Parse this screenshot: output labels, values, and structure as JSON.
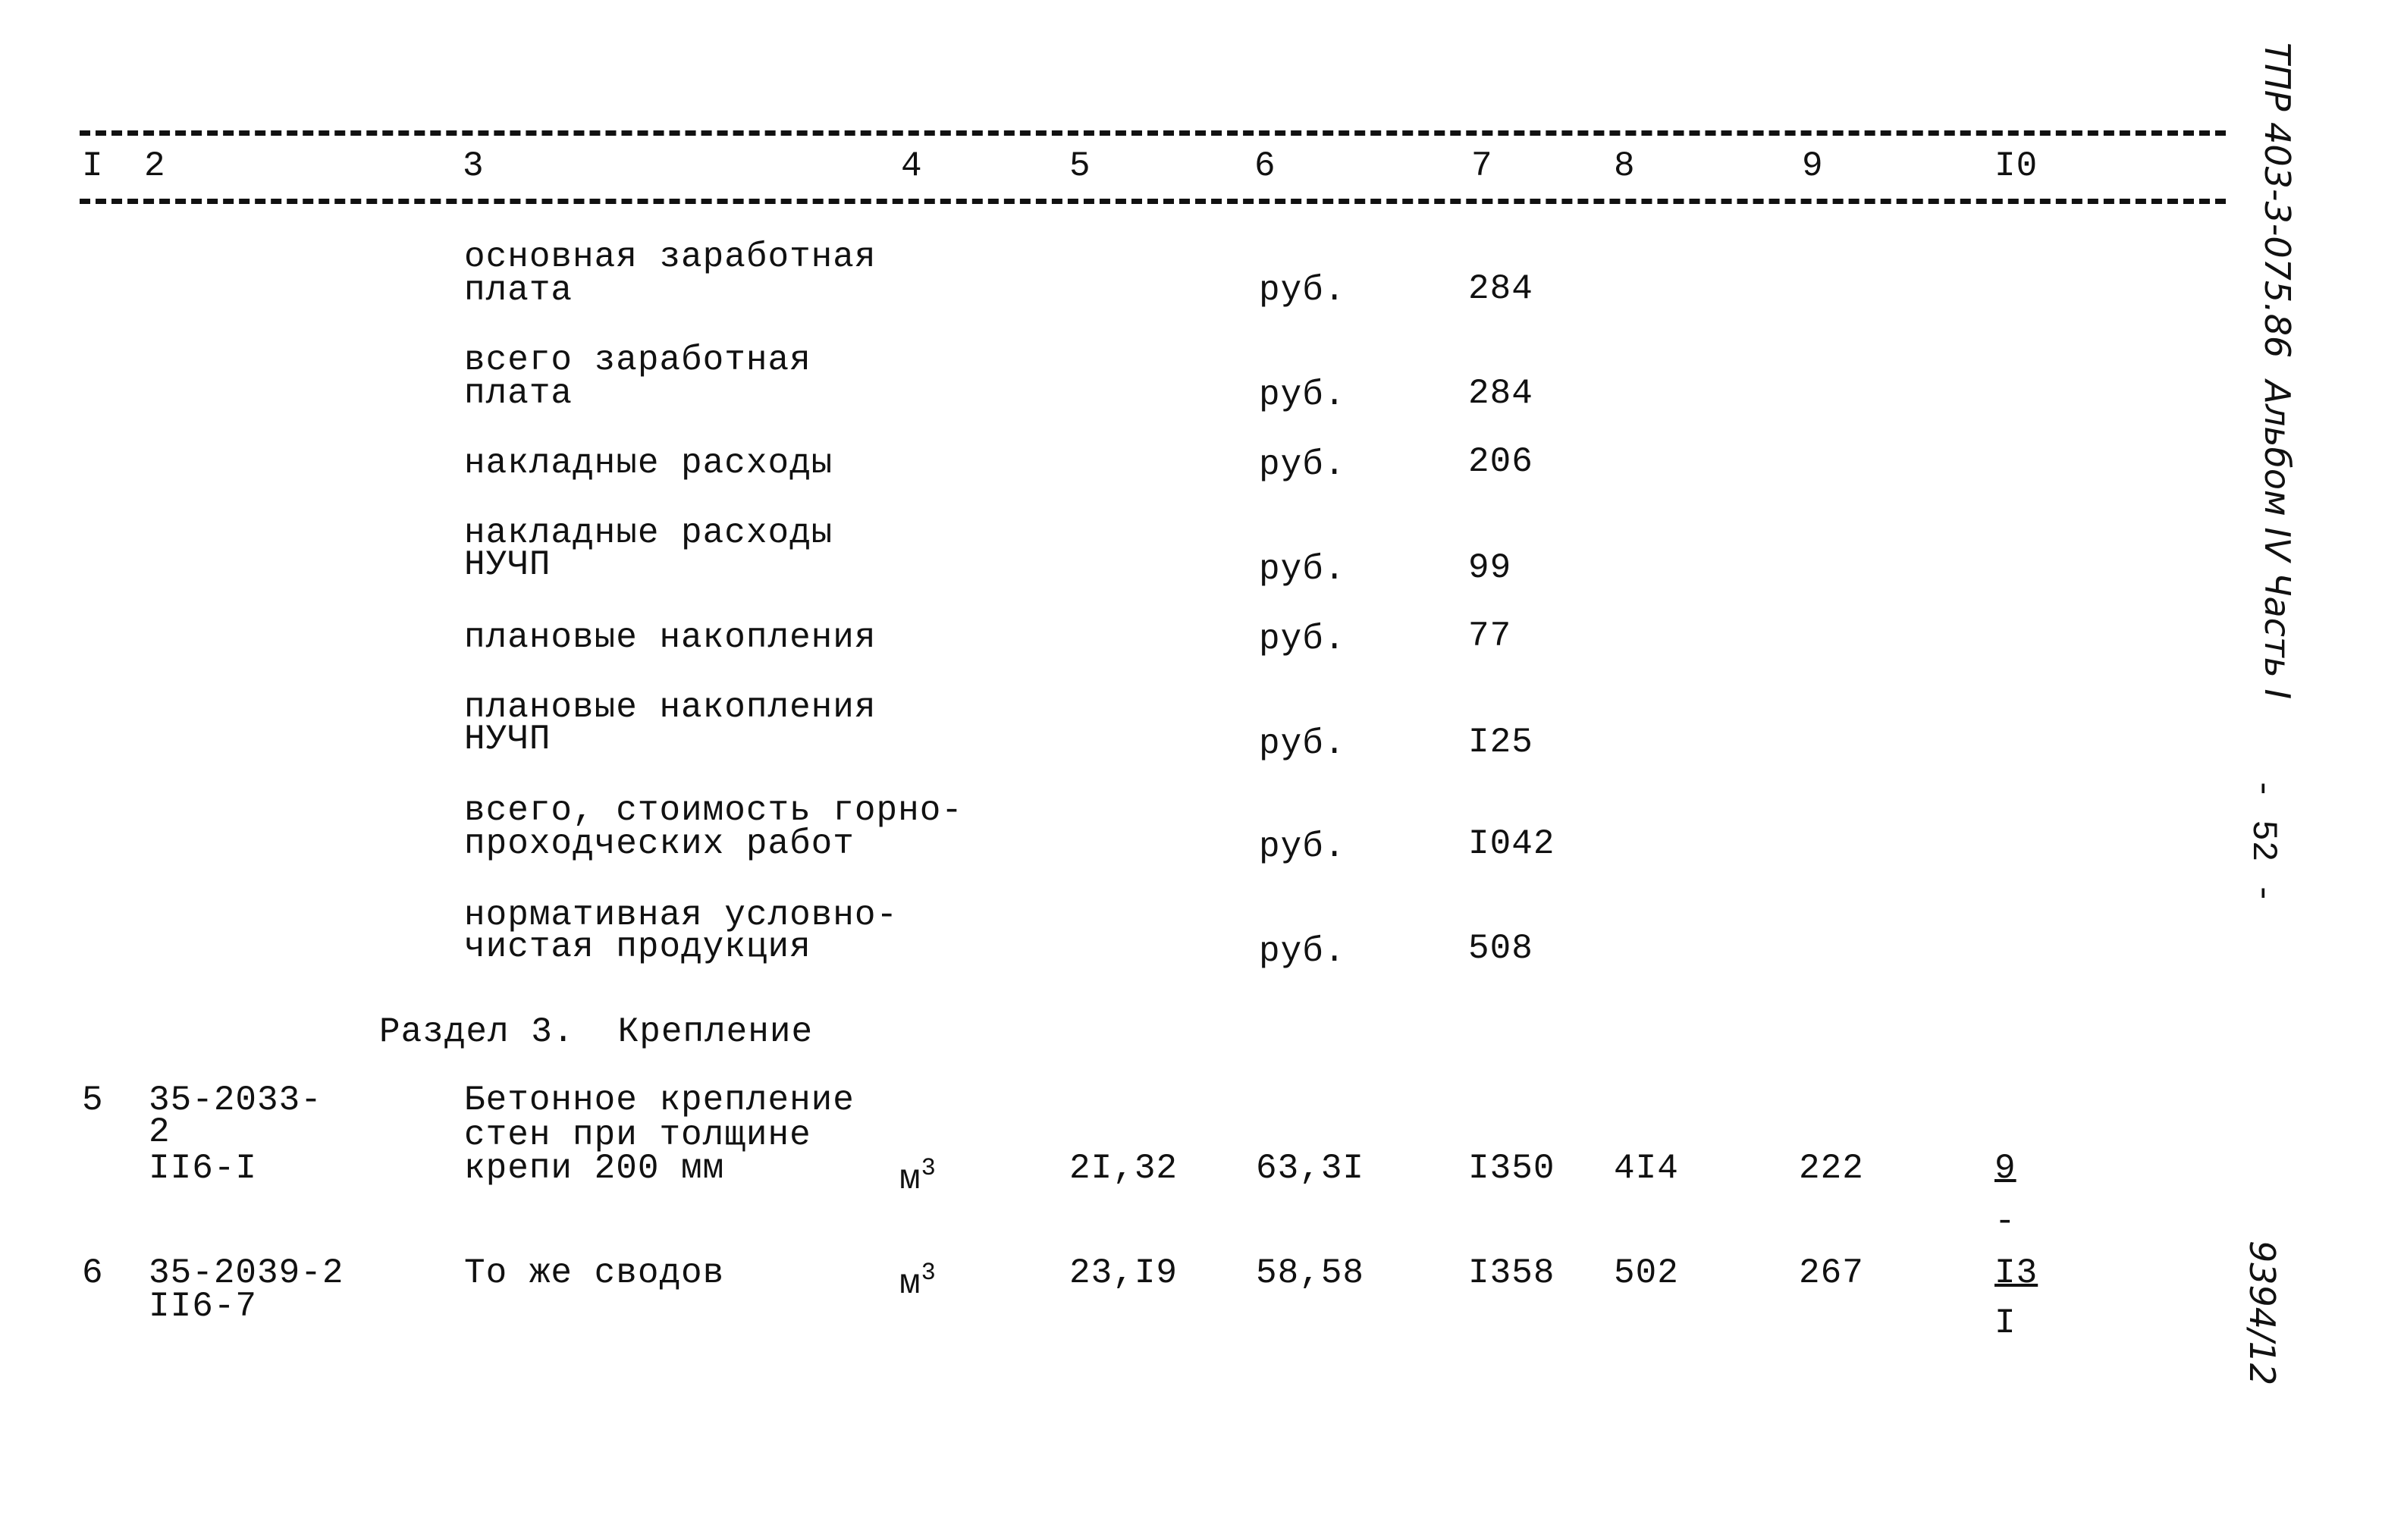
{
  "header_columns": [
    "I",
    "2",
    "3",
    "4",
    "5",
    "6",
    "7",
    "8",
    "9",
    "I0"
  ],
  "cost_items": [
    {
      "lines": [
        "основная заработная",
        "плата"
      ],
      "unit": "руб.",
      "value": "284"
    },
    {
      "lines": [
        "всего заработная",
        "плата"
      ],
      "unit": "руб.",
      "value": "284"
    },
    {
      "lines": [
        "накладные расходы"
      ],
      "unit": "руб.",
      "value": "206"
    },
    {
      "lines": [
        "накладные расходы",
        "НУЧП"
      ],
      "unit": "руб.",
      "value": "99"
    },
    {
      "lines": [
        "плановые накопления"
      ],
      "unit": "руб.",
      "value": "77"
    },
    {
      "lines": [
        "плановые накопления",
        "НУЧП"
      ],
      "unit": "руб.",
      "value": "I25"
    },
    {
      "lines": [
        "всего, стоимость горно-",
        "проходческих работ"
      ],
      "unit": "руб.",
      "value": "I042"
    },
    {
      "lines": [
        "нормативная условно-",
        "чистая продукция"
      ],
      "unit": "руб.",
      "value": "508"
    }
  ],
  "section_title": "Раздел 3.  Крепление",
  "rows": [
    {
      "no": "5",
      "code_lines": [
        "35-2033-",
        "2",
        "II6-I"
      ],
      "desc_lines": [
        "Бетонное крепление",
        "стен при толщине",
        "крепи 200 мм"
      ],
      "unit": "м",
      "unit_sup": "3",
      "c5": "2I,32",
      "c6": "63,3I",
      "c7": "I350",
      "c8": "4I4",
      "c9": "222",
      "c10_top": "9",
      "c10_bottom": "-"
    },
    {
      "no": "6",
      "code_lines": [
        "35-2039-2",
        "II6-7"
      ],
      "desc_lines": [
        "То же сводов"
      ],
      "unit": "м",
      "unit_sup": "3",
      "c5": "23,I9",
      "c6": "58,58",
      "c7": "I358",
      "c8": "502",
      "c9": "267",
      "c10_top": "I3",
      "c10_bottom": "I"
    }
  ],
  "margin": {
    "doc_ref": "ТПР 403-3-075.86  Альбом IV Часть I",
    "page": "- 52 -",
    "inventory": "9394/12"
  }
}
